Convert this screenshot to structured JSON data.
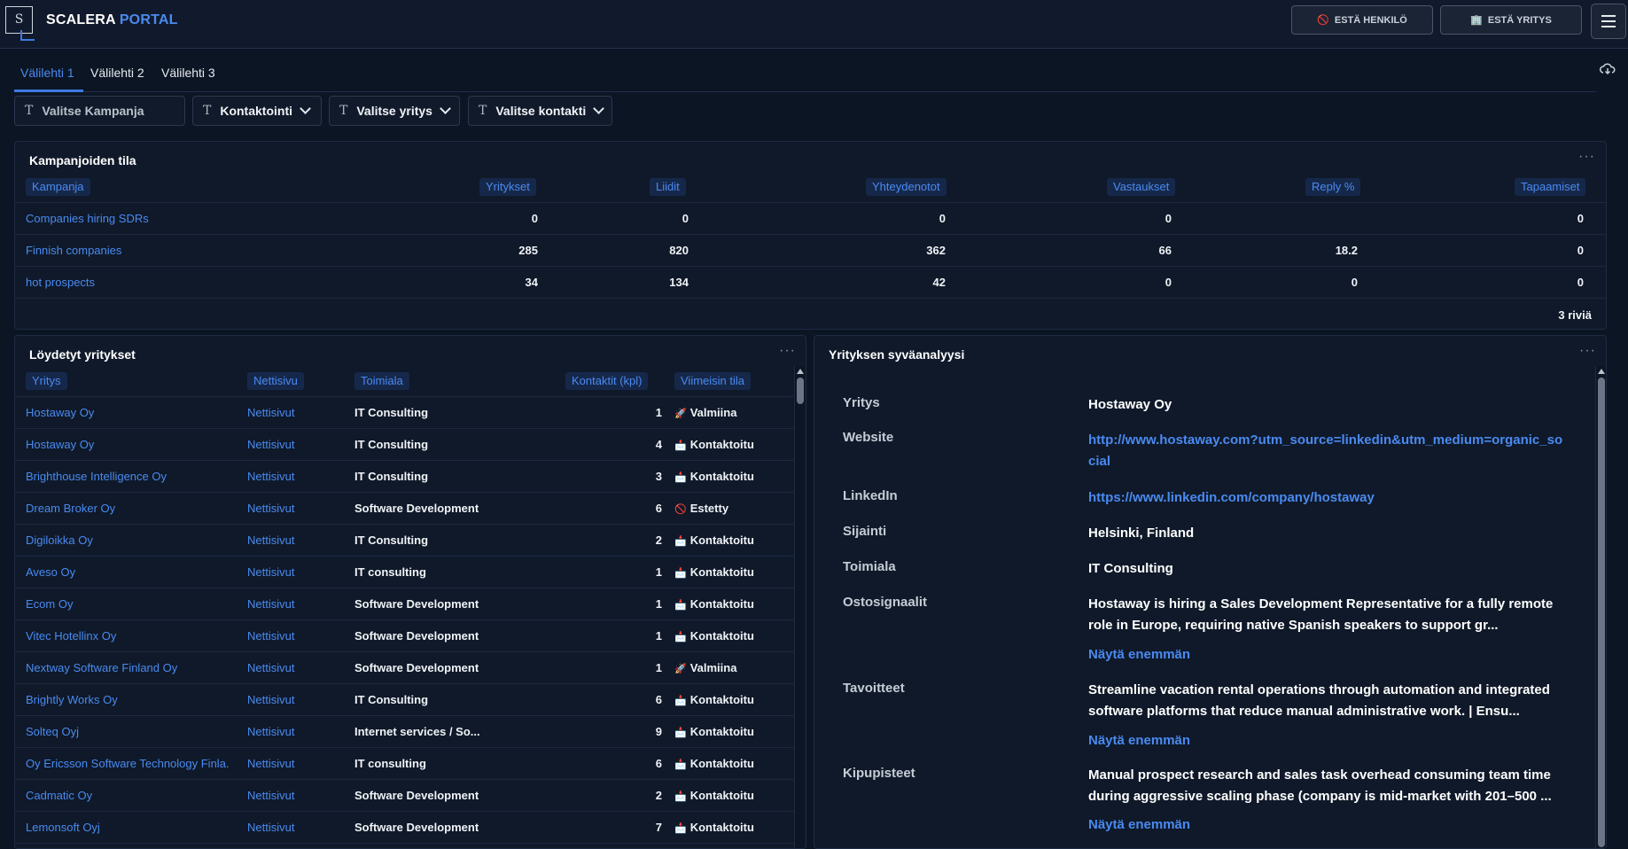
{
  "header": {
    "logo_letter": "S",
    "brand_part1": "SCALERA",
    "brand_part2": "PORTAL",
    "block_person_label": "ESTÄ HENKILÖ",
    "block_person_icon": "🚫",
    "block_company_label": "ESTÄ YRITYS",
    "block_company_icon": "🏢"
  },
  "tabs": [
    {
      "label": "Välilehti 1"
    },
    {
      "label": "Välilehti 2"
    },
    {
      "label": "Välilehti 3"
    }
  ],
  "filters": {
    "campaign_placeholder": "Valitse Kampanja",
    "contacting": "Kontaktointi",
    "company": "Valitse yritys",
    "contact": "Valitse kontakti"
  },
  "campaigns": {
    "title": "Kampanjoiden tila",
    "columns": [
      "Kampanja",
      "Yritykset",
      "Liidit",
      "Yhteydenotot",
      "Vastaukset",
      "Reply %",
      "Tapaamiset"
    ],
    "rows": [
      {
        "name": "Companies hiring SDRs",
        "companies": "0",
        "leads": "0",
        "contacts": "0",
        "replies": "0",
        "reply_pct": "",
        "meetings": "0"
      },
      {
        "name": "Finnish companies",
        "companies": "285",
        "leads": "820",
        "contacts": "362",
        "replies": "66",
        "reply_pct": "18.2",
        "meetings": "0"
      },
      {
        "name": "hot prospects",
        "companies": "34",
        "leads": "134",
        "contacts": "42",
        "replies": "0",
        "reply_pct": "0",
        "meetings": "0"
      }
    ],
    "row_count": "3 riviä"
  },
  "companies": {
    "title": "Löydetyt yritykset",
    "columns": [
      "Yritys",
      "Nettisivu",
      "Toimiala",
      "Kontaktit (kpl)",
      "Viimeisin tila"
    ],
    "rows": [
      {
        "name": "Hostaway Oy",
        "site": "Nettisivut",
        "industry": "IT Consulting",
        "contacts": "1",
        "status_icon": "🚀",
        "status": "Valmiina"
      },
      {
        "name": "Hostaway Oy",
        "site": "Nettisivut",
        "industry": "IT Consulting",
        "contacts": "4",
        "status_icon": "📩",
        "status": "Kontaktoitu"
      },
      {
        "name": "Brighthouse Intelligence Oy",
        "site": "Nettisivut",
        "industry": "IT Consulting",
        "contacts": "3",
        "status_icon": "📩",
        "status": "Kontaktoitu"
      },
      {
        "name": "Dream Broker Oy",
        "site": "Nettisivut",
        "industry": "Software Development",
        "contacts": "6",
        "status_icon": "🚫",
        "status": "Estetty"
      },
      {
        "name": "Digiloikka Oy",
        "site": "Nettisivut",
        "industry": "IT Consulting",
        "contacts": "2",
        "status_icon": "📩",
        "status": "Kontaktoitu"
      },
      {
        "name": "Aveso Oy",
        "site": "Nettisivut",
        "industry": "IT consulting",
        "contacts": "1",
        "status_icon": "📩",
        "status": "Kontaktoitu"
      },
      {
        "name": "Ecom Oy",
        "site": "Nettisivut",
        "industry": "Software Development",
        "contacts": "1",
        "status_icon": "📩",
        "status": "Kontaktoitu"
      },
      {
        "name": "Vitec Hotellinx Oy",
        "site": "Nettisivut",
        "industry": "Software Development",
        "contacts": "1",
        "status_icon": "📩",
        "status": "Kontaktoitu"
      },
      {
        "name": "Nextway Software Finland Oy",
        "site": "Nettisivut",
        "industry": "Software Development",
        "contacts": "1",
        "status_icon": "🚀",
        "status": "Valmiina"
      },
      {
        "name": "Brightly Works Oy",
        "site": "Nettisivut",
        "industry": "IT Consulting",
        "contacts": "6",
        "status_icon": "📩",
        "status": "Kontaktoitu"
      },
      {
        "name": "Solteq Oyj",
        "site": "Nettisivut",
        "industry": "Internet services / So...",
        "contacts": "9",
        "status_icon": "📩",
        "status": "Kontaktoitu"
      },
      {
        "name": "Oy Ericsson Software Technology Finla...",
        "site": "Nettisivut",
        "industry": "IT consulting",
        "contacts": "6",
        "status_icon": "📩",
        "status": "Kontaktoitu"
      },
      {
        "name": "Cadmatic Oy",
        "site": "Nettisivut",
        "industry": "Software Development",
        "contacts": "2",
        "status_icon": "📩",
        "status": "Kontaktoitu"
      },
      {
        "name": "Lemonsoft Oyj",
        "site": "Nettisivut",
        "industry": "Software Development",
        "contacts": "7",
        "status_icon": "📩",
        "status": "Kontaktoitu"
      }
    ]
  },
  "analysis": {
    "title": "Yrityksen syväanalyysi",
    "company_label": "Yritys",
    "company_value": "Hostaway Oy",
    "website_label": "Website",
    "website_value": "http://www.hostaway.com?utm_source=linkedin&utm_medium=organic_social",
    "linkedin_label": "LinkedIn",
    "linkedin_value": "https://www.linkedin.com/company/hostaway",
    "location_label": "Sijainti",
    "location_value": "Helsinki, Finland",
    "industry_label": "Toimiala",
    "industry_value": "IT Consulting",
    "signals_label": "Ostosignaalit",
    "signals_value": "Hostaway is hiring a Sales Development Representative for a fully remote role in Europe, requiring native Spanish speakers to support gr...",
    "goals_label": "Tavoitteet",
    "goals_value": "Streamline vacation rental operations through automation and integrated software platforms that reduce manual administrative work. | Ensu...",
    "pain_label": "Kipupisteet",
    "pain_value": "Manual prospect research and sales task overhead consuming team time during aggressive scaling phase (company is mid-market with 201–500 ...",
    "show_more": "Näytä enemmän"
  },
  "colors": {
    "accent": "#4a8af0",
    "background": "#0c1524",
    "panel": "#0f1929"
  }
}
